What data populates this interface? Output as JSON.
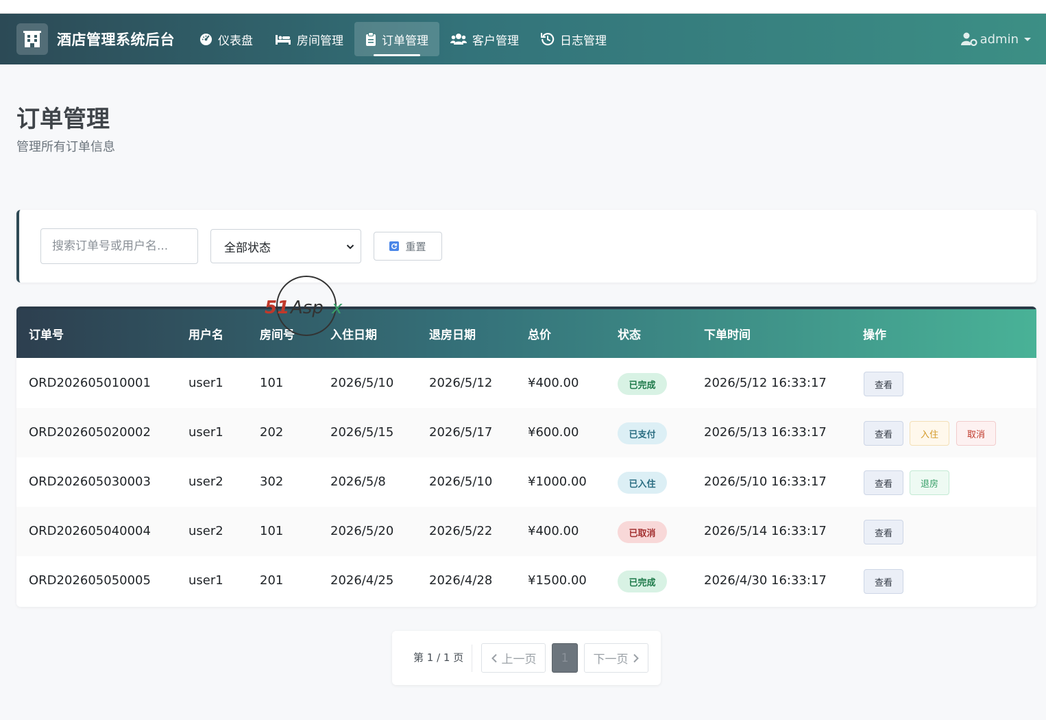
{
  "navbar": {
    "brand": "酒店管理系统后台",
    "items": [
      {
        "label": "仪表盘",
        "icon": "dashboard-icon"
      },
      {
        "label": "房间管理",
        "icon": "bed-icon"
      },
      {
        "label": "订单管理",
        "icon": "clipboard-icon",
        "active": true
      },
      {
        "label": "客户管理",
        "icon": "users-icon"
      },
      {
        "label": "日志管理",
        "icon": "history-icon"
      }
    ],
    "user": "admin"
  },
  "page": {
    "title": "订单管理",
    "subtitle": "管理所有订单信息"
  },
  "filters": {
    "search_placeholder": "搜索订单号或用户名...",
    "search_value": "",
    "status_selected": "全部状态",
    "reset_label": "重置"
  },
  "table": {
    "headers": [
      "订单号",
      "用户名",
      "房间号",
      "入住日期",
      "退房日期",
      "总价",
      "状态",
      "下单时间",
      "操作"
    ],
    "rows": [
      {
        "order_no": "ORD202605010001",
        "user": "user1",
        "room": "101",
        "checkin": "2026/5/10",
        "checkout": "2026/5/12",
        "total": "¥400.00",
        "status": "已完成",
        "created": "2026/5/12 16:33:17",
        "actions": [
          "查看"
        ]
      },
      {
        "order_no": "ORD202605020002",
        "user": "user1",
        "room": "202",
        "checkin": "2026/5/15",
        "checkout": "2026/5/17",
        "total": "¥600.00",
        "status": "已支付",
        "created": "2026/5/13 16:33:17",
        "actions": [
          "查看",
          "入住",
          "取消"
        ]
      },
      {
        "order_no": "ORD202605030003",
        "user": "user2",
        "room": "302",
        "checkin": "2026/5/8",
        "checkout": "2026/5/10",
        "total": "¥1000.00",
        "status": "已入住",
        "created": "2026/5/10 16:33:17",
        "actions": [
          "查看",
          "退房"
        ]
      },
      {
        "order_no": "ORD202605040004",
        "user": "user2",
        "room": "101",
        "checkin": "2026/5/20",
        "checkout": "2026/5/22",
        "total": "¥400.00",
        "status": "已取消",
        "created": "2026/5/14 16:33:17",
        "actions": [
          "查看"
        ]
      },
      {
        "order_no": "ORD202605050005",
        "user": "user1",
        "room": "201",
        "checkin": "2026/4/25",
        "checkout": "2026/4/28",
        "total": "¥1500.00",
        "status": "已完成",
        "created": "2026/4/30 16:33:17",
        "actions": [
          "查看"
        ]
      }
    ]
  },
  "pagination": {
    "info": "第 1 / 1 页",
    "prev": "上一页",
    "next": "下一页",
    "current": "1"
  },
  "watermark": {
    "brand": "51Aspx"
  },
  "colors": {
    "nav_start": "#2c4a56",
    "nav_end": "#3c8f85",
    "status_done": "#1e7a4a",
    "status_paid": "#2b6e82",
    "status_cancelled": "#a33131"
  }
}
